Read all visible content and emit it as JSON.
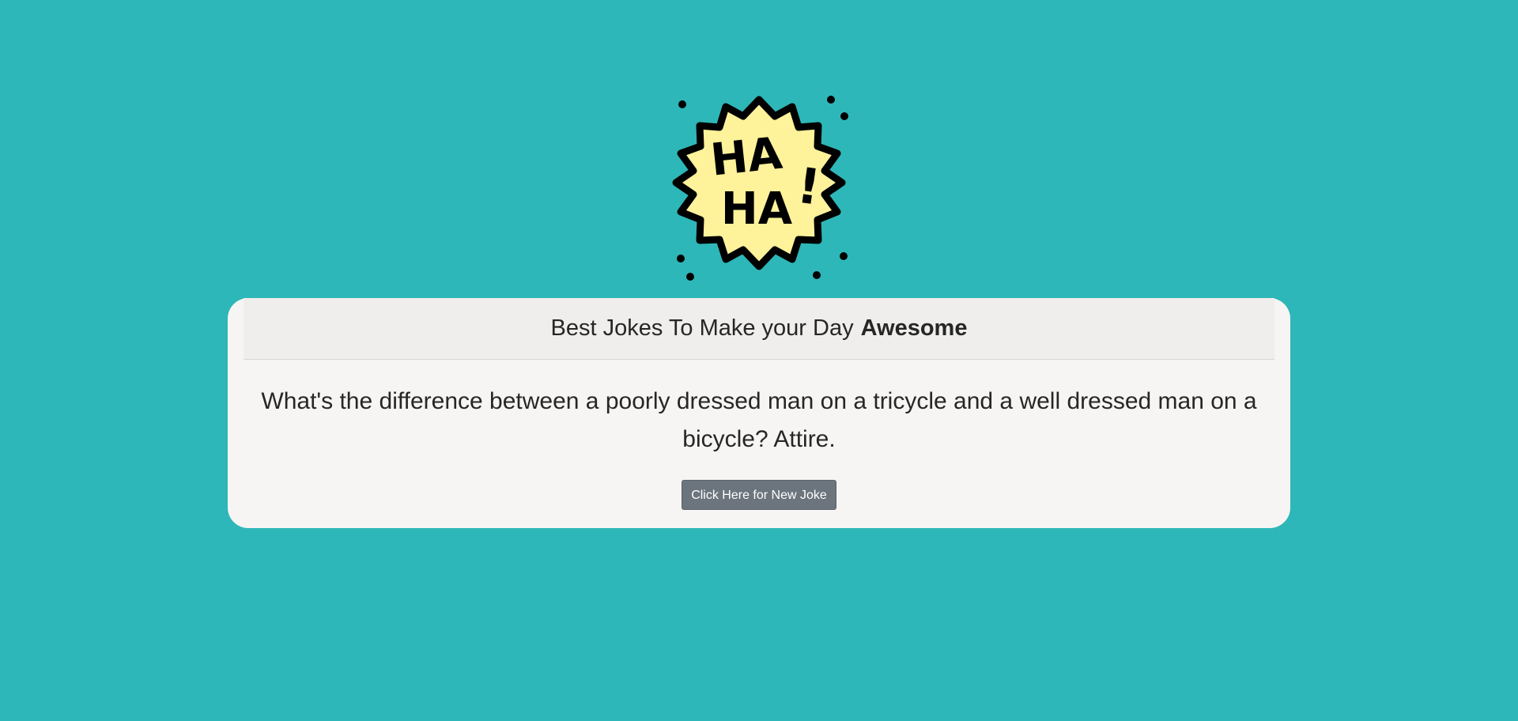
{
  "logo": {
    "icon": "haha-burst-icon",
    "text_line1": "HA",
    "text_line2": "HA",
    "exclaim": "!",
    "fill": "#fef29b",
    "stroke": "#000000"
  },
  "card": {
    "title_prefix": "Best Jokes To Make your Day",
    "title_emphasis": "Awesome",
    "joke": "What's the difference between a poorly dressed man on a tricycle and a well dressed man on a bicycle? Attire.",
    "button_label": "Click Here for New Joke"
  },
  "colors": {
    "background": "#2eb7b8",
    "card": "#f7f5f3",
    "button": "#6c757d"
  }
}
